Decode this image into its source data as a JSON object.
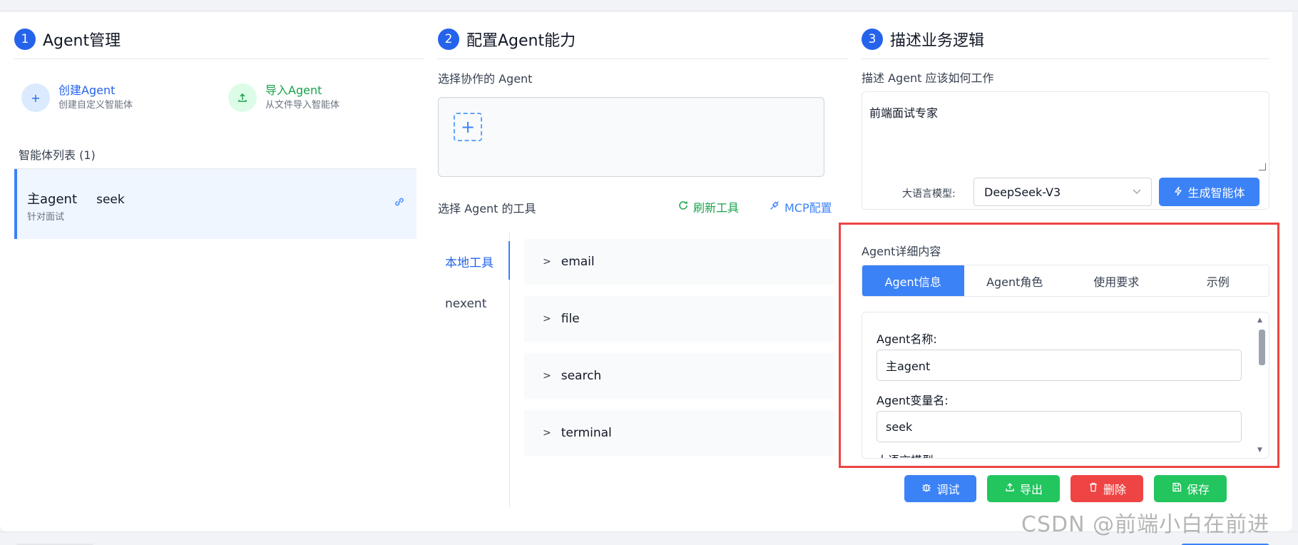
{
  "col1": {
    "step": "1",
    "title": "Agent管理",
    "create": {
      "title": "创建Agent",
      "subtitle": "创建自定义智能体",
      "icon": "plus-icon"
    },
    "import": {
      "title": "导入Agent",
      "subtitle": "从文件导入智能体",
      "icon": "upload-icon"
    },
    "list_label": "智能体列表 (1)",
    "agents": [
      {
        "name": "主agent",
        "var": "seek",
        "desc": "针对面试",
        "icon": "link-icon"
      }
    ]
  },
  "col2": {
    "step": "2",
    "title": "配置Agent能力",
    "collab_label": "选择协作的 Agent",
    "tools_label": "选择 Agent 的工具",
    "refresh": "刷新工具",
    "mcp": "MCP配置",
    "side_tabs": [
      "本地工具",
      "nexent"
    ],
    "tools": [
      "email",
      "file",
      "search",
      "terminal"
    ]
  },
  "col3": {
    "step": "3",
    "title": "描述业务逻辑",
    "desc_label": "描述 Agent 应该如何工作",
    "desc_value": "前端面试专家",
    "model_label": "大语言模型:",
    "model_value": "DeepSeek-V3",
    "generate": "生成智能体",
    "detail_title": "Agent详细内容",
    "tabs": [
      "Agent信息",
      "Agent角色",
      "使用要求",
      "示例"
    ],
    "active_tab": 0,
    "fields": {
      "name_label": "Agent名称:",
      "name_value": "主agent",
      "var_label": "Agent变量名:",
      "var_value": "seek",
      "model_label_partial": "大语言模型:"
    },
    "actions": [
      "调试",
      "导出",
      "删除",
      "保存"
    ]
  },
  "watermark": "CSDN @前端小白在前进",
  "colors": {
    "primary": "#3b82f6",
    "green": "#22c55e",
    "red": "#ef4444",
    "highlight_frame": "#ef4444"
  }
}
